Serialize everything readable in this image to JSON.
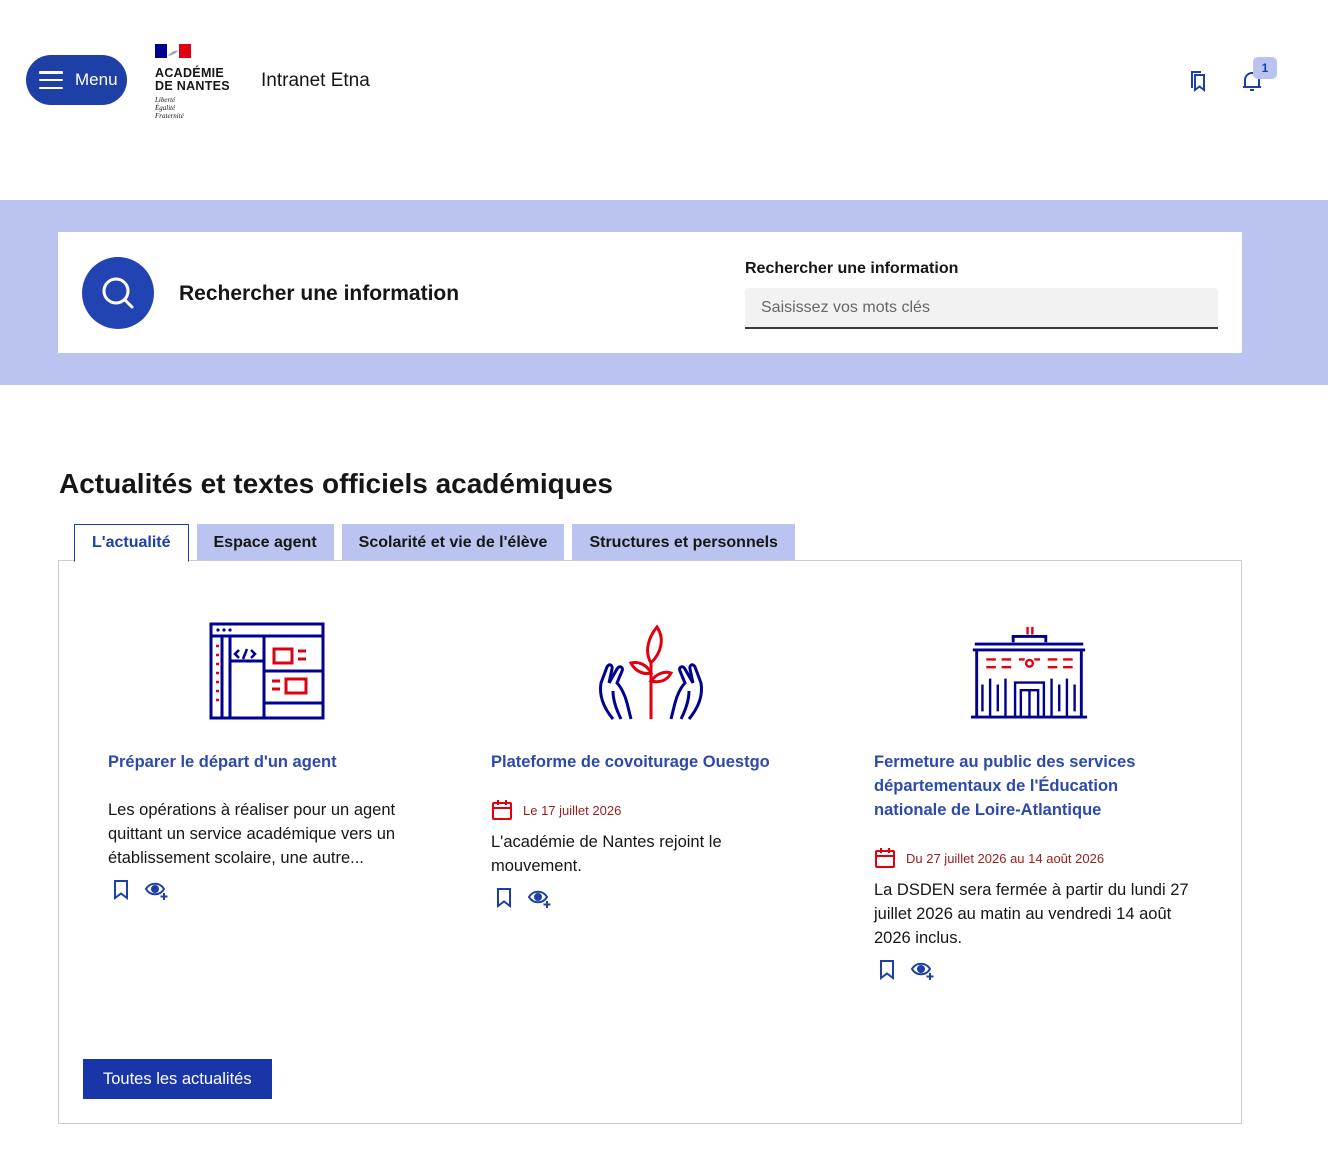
{
  "header": {
    "menu_label": "Menu",
    "logo": {
      "line1": "ACADÉMIE",
      "line2": "DE NANTES",
      "motto": [
        "Liberté",
        "Égalité",
        "Fraternité"
      ]
    },
    "site_title": "Intranet Etna",
    "notification_count": "1"
  },
  "search": {
    "heading": "Rechercher une information",
    "field_label": "Rechercher une information",
    "placeholder": "Saisissez vos mots clés",
    "value": ""
  },
  "news": {
    "section_title": "Actualités et textes officiels académiques",
    "tabs": [
      {
        "label": "L'actualité",
        "active": true
      },
      {
        "label": "Espace agent",
        "active": false
      },
      {
        "label": "Scolarité et vie de l'élève",
        "active": false
      },
      {
        "label": "Structures et personnels",
        "active": false
      }
    ],
    "cards": [
      {
        "title": "Préparer le départ d'un agent",
        "date": "",
        "description": "Les opérations à réaliser pour un agent quittant un service académique vers un établissement scolaire, une autre..."
      },
      {
        "title": "Plateforme de covoiturage Ouestgo",
        "date": "Le 17 juillet 2026",
        "description": "L'académie de Nantes rejoint le mouvement."
      },
      {
        "title": "Fermeture au public des services départementaux de l'Éducation nationale de Loire-Atlantique",
        "date": "Du 27 juillet 2026 au 14 août 2026",
        "description": "La DSDEN sera fermée à partir du lundi 27 juillet 2026 au matin au vendredi 14 août 2026 inclus."
      }
    ],
    "all_news_label": "Toutes les actualités"
  },
  "colors": {
    "primary": "#1d3fa6",
    "band": "#bbc4f0",
    "date_red": "#9b1c1c",
    "illus_blue": "#000091",
    "illus_red": "#e1000f"
  }
}
